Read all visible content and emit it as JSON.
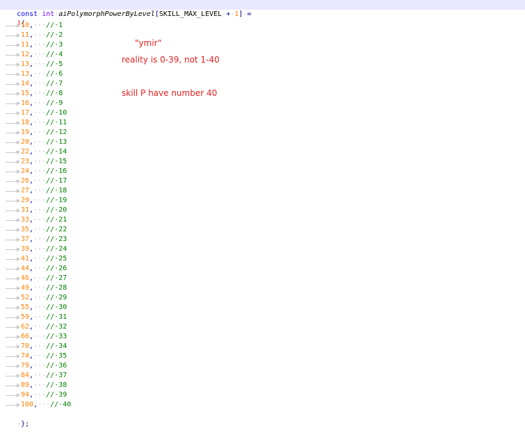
{
  "code": {
    "decl": {
      "kw": "const",
      "type": "int",
      "name": "aiPolymorphPowerByLevel",
      "bracket_open": "[",
      "size_expr": "SKILL_MAX_LEVEL",
      "plus": "+",
      "one": "1",
      "bracket_close": "]",
      "assign": "="
    },
    "open_brace": "{",
    "close_brace": "};",
    "entries": [
      {
        "value": "10",
        "level": "1"
      },
      {
        "value": "11",
        "level": "2"
      },
      {
        "value": "11",
        "level": "3"
      },
      {
        "value": "12",
        "level": "4"
      },
      {
        "value": "13",
        "level": "5"
      },
      {
        "value": "13",
        "level": "6"
      },
      {
        "value": "14",
        "level": "7"
      },
      {
        "value": "15",
        "level": "8"
      },
      {
        "value": "16",
        "level": "9"
      },
      {
        "value": "17",
        "level": "10"
      },
      {
        "value": "18",
        "level": "11"
      },
      {
        "value": "19",
        "level": "12"
      },
      {
        "value": "20",
        "level": "13"
      },
      {
        "value": "22",
        "level": "14"
      },
      {
        "value": "23",
        "level": "15"
      },
      {
        "value": "24",
        "level": "16"
      },
      {
        "value": "26",
        "level": "17"
      },
      {
        "value": "27",
        "level": "18"
      },
      {
        "value": "29",
        "level": "19"
      },
      {
        "value": "31",
        "level": "20"
      },
      {
        "value": "33",
        "level": "21"
      },
      {
        "value": "35",
        "level": "22"
      },
      {
        "value": "37",
        "level": "23"
      },
      {
        "value": "39",
        "level": "24"
      },
      {
        "value": "41",
        "level": "25"
      },
      {
        "value": "44",
        "level": "26"
      },
      {
        "value": "46",
        "level": "27"
      },
      {
        "value": "49",
        "level": "28"
      },
      {
        "value": "52",
        "level": "29"
      },
      {
        "value": "55",
        "level": "30"
      },
      {
        "value": "59",
        "level": "31"
      },
      {
        "value": "62",
        "level": "32"
      },
      {
        "value": "66",
        "level": "33"
      },
      {
        "value": "70",
        "level": "34"
      },
      {
        "value": "74",
        "level": "35"
      },
      {
        "value": "79",
        "level": "36"
      },
      {
        "value": "84",
        "level": "37"
      },
      {
        "value": "89",
        "level": "38"
      },
      {
        "value": "94",
        "level": "39"
      },
      {
        "value": "100",
        "level": "40"
      }
    ]
  },
  "annotations": {
    "a1": "\"ymir\"",
    "a2": "reality is 0-39, not 1-40",
    "a3": "skill P have number 40"
  },
  "colors": {
    "annotation": "#e02020",
    "comment": "#008000",
    "number": "#ff8000",
    "current_line": "#e8e8ff"
  }
}
